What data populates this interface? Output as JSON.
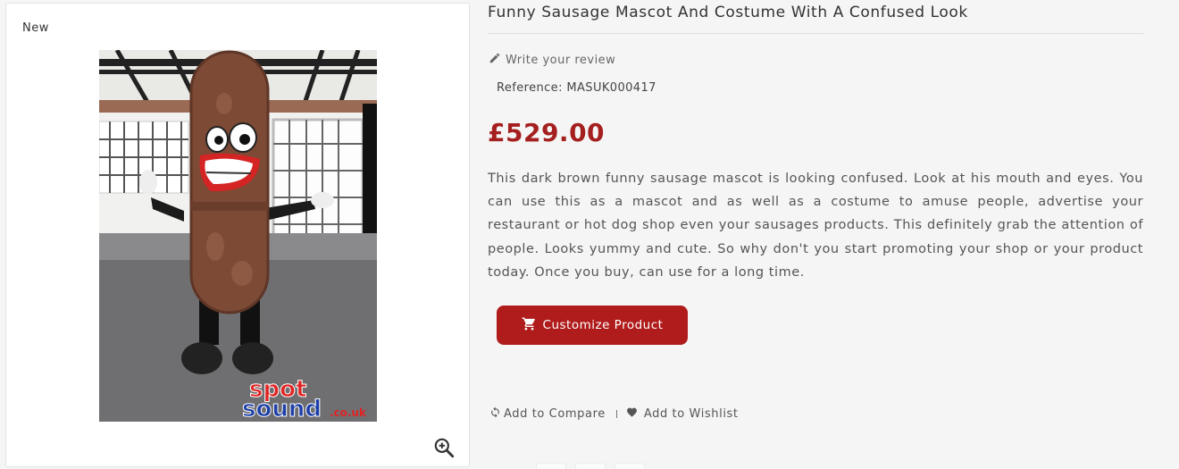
{
  "image_card": {
    "badge": "New",
    "photo_alt": "Funny Sausage Mascot And Costume With A Confused Look",
    "watermark": {
      "line1": "spot",
      "line2": "sound",
      "domain": ".co.uk"
    }
  },
  "product": {
    "title": "Funny Sausage Mascot And Costume With A Confused Look",
    "review_link": "Write your review",
    "reference_label": "Reference:",
    "reference_value": "MASUK000417",
    "price": "£529.00",
    "description": "This dark brown funny sausage mascot is looking confused. Look at his mouth and eyes. You can use this as a mascot and as well as a costume to amuse people, advertise your restaurant or hot dog shop even your sausages products. This definitely grab the attention of people. Looks yummy and cute. So why don't you start promoting your shop or your product today. Once you buy, can use for a long time.",
    "customize_button": "Customize Product",
    "compare_link": "Add to Compare",
    "wishlist_link": "Add to Wishlist"
  },
  "icons": {
    "zoom": "zoom-in-icon",
    "review": "pencil-icon",
    "cart": "cart-icon",
    "compare": "refresh-icon",
    "wishlist": "heart-icon"
  },
  "colors": {
    "accent": "#b01c1c",
    "price": "#a51f1f",
    "background": "#f5f5f5"
  }
}
